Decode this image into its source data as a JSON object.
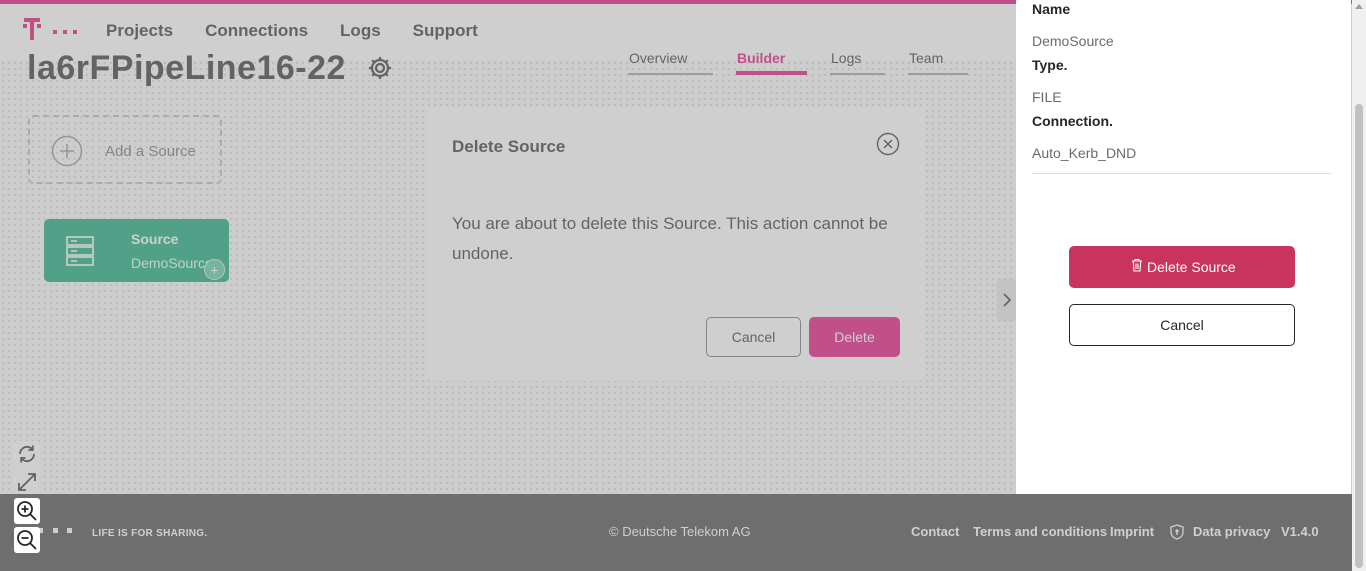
{
  "header": {
    "nav": [
      "Projects",
      "Connections",
      "Logs",
      "Support"
    ]
  },
  "pipeline": {
    "title": "la6rFPipeLine16-22",
    "tabs": [
      "Overview",
      "Builder",
      "Logs",
      "Team"
    ],
    "active_tab": "Builder"
  },
  "canvas": {
    "add_source_label": "Add a Source",
    "node": {
      "type_label": "Source",
      "name": "DemoSource"
    }
  },
  "modal": {
    "title": "Delete Source",
    "message": "You are about to delete this Source. This action cannot be undone.",
    "cancel_label": "Cancel",
    "delete_label": "Delete"
  },
  "side_panel": {
    "fields": [
      {
        "label": "Name",
        "value": "DemoSource"
      },
      {
        "label": "Type.",
        "value": "FILE"
      },
      {
        "label": "Connection.",
        "value": "Auto_Kerb_DND"
      }
    ],
    "delete_label": "Delete Source",
    "cancel_label": "Cancel"
  },
  "footer": {
    "slogan": "LIFE IS FOR SHARING.",
    "copyright": "© Deutsche Telekom AG",
    "links": [
      "Contact",
      "Terms and conditions",
      "Imprint",
      "Data privacy",
      "V1.4.0"
    ]
  },
  "colors": {
    "brand": "#e20074",
    "source_node": "#00a36e",
    "danger_button": "#c9345e",
    "footer_bg": "#3d3d3d"
  },
  "icons": [
    "telekom-logo-icon",
    "gear-icon",
    "add-circle-icon",
    "server-icon",
    "add-icon",
    "close-circle-icon",
    "chevron-right-icon",
    "refresh-icon",
    "fit-screen-icon",
    "zoom-in-icon",
    "zoom-out-icon",
    "trash-icon",
    "shield-icon"
  ]
}
